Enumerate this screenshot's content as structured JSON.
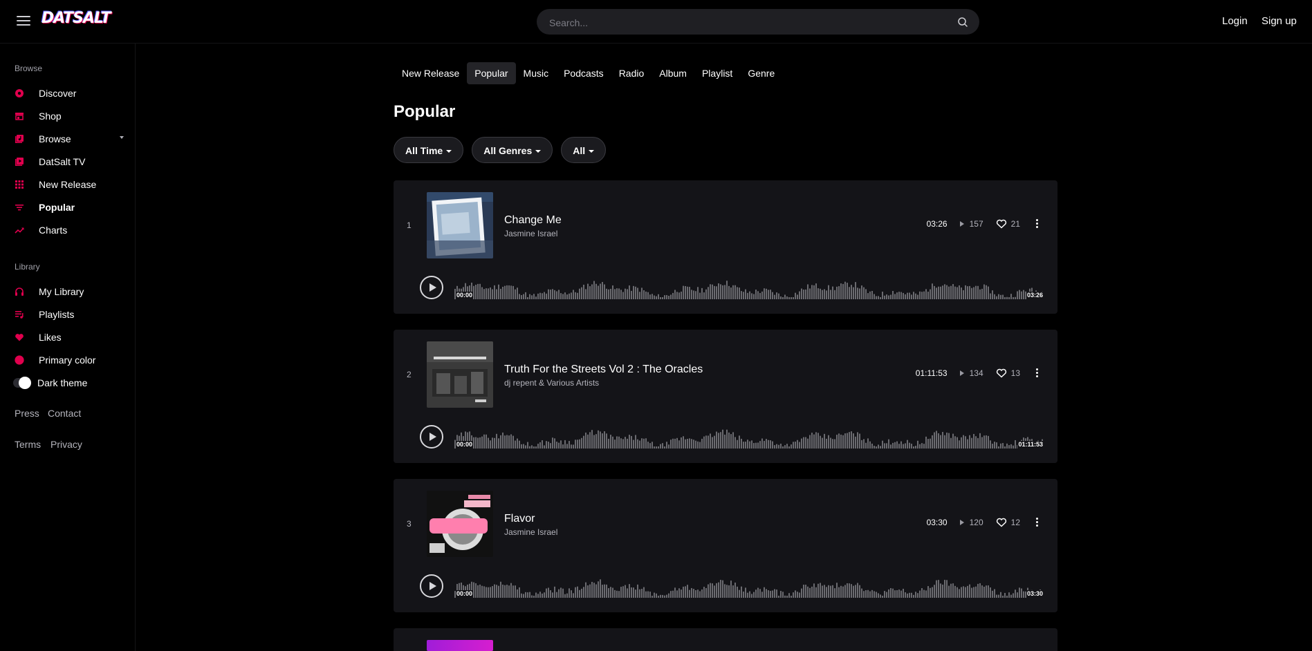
{
  "header": {
    "logo": "DATSALT",
    "search_placeholder": "Search...",
    "login": "Login",
    "signup": "Sign up"
  },
  "sidebar": {
    "browse_heading": "Browse",
    "browse_items": [
      {
        "label": "Discover",
        "icon": "disc-icon"
      },
      {
        "label": "Shop",
        "icon": "store-icon"
      },
      {
        "label": "Browse",
        "icon": "music-library-icon"
      },
      {
        "label": "DatSalt TV",
        "icon": "video-library-icon"
      },
      {
        "label": "New Release",
        "icon": "grid-icon"
      },
      {
        "label": "Popular",
        "icon": "filter-list-icon"
      },
      {
        "label": "Charts",
        "icon": "trending-up-icon"
      }
    ],
    "library_heading": "Library",
    "library_items": [
      {
        "label": "My Library",
        "icon": "headphones-icon"
      },
      {
        "label": "Playlists",
        "icon": "playlist-icon"
      },
      {
        "label": "Likes",
        "icon": "heart-icon"
      },
      {
        "label": "Primary color",
        "icon": "color-dot-icon"
      },
      {
        "label": "Dark theme",
        "icon": "toggle-icon"
      }
    ],
    "footer1": [
      "Press",
      "Contact"
    ],
    "footer2": [
      "Terms",
      "Privacy"
    ]
  },
  "tabs": [
    "New Release",
    "Popular",
    "Music",
    "Podcasts",
    "Radio",
    "Album",
    "Playlist",
    "Genre"
  ],
  "active_tab": "Popular",
  "page_title": "Popular",
  "filters": [
    "All Time",
    "All Genres",
    "All"
  ],
  "tracks": [
    {
      "rank": "1",
      "title": "Change Me",
      "artist": "Jasmine Israel",
      "duration": "03:26",
      "plays": "157",
      "likes": "21",
      "start": "00:00",
      "end": "03:26"
    },
    {
      "rank": "2",
      "title": "Truth For the Streets Vol 2 : The Oracles",
      "artist": "dj repent & Various Artists",
      "duration": "01:11:53",
      "plays": "134",
      "likes": "13",
      "start": "00:00",
      "end": "01:11:53"
    },
    {
      "rank": "3",
      "title": "Flavor",
      "artist": "Jasmine Israel",
      "duration": "03:30",
      "plays": "120",
      "likes": "12",
      "start": "00:00",
      "end": "03:30"
    }
  ],
  "colors": {
    "accent": "#e0004d",
    "card_bg": "#141418",
    "waveform": "#6b6b70"
  }
}
